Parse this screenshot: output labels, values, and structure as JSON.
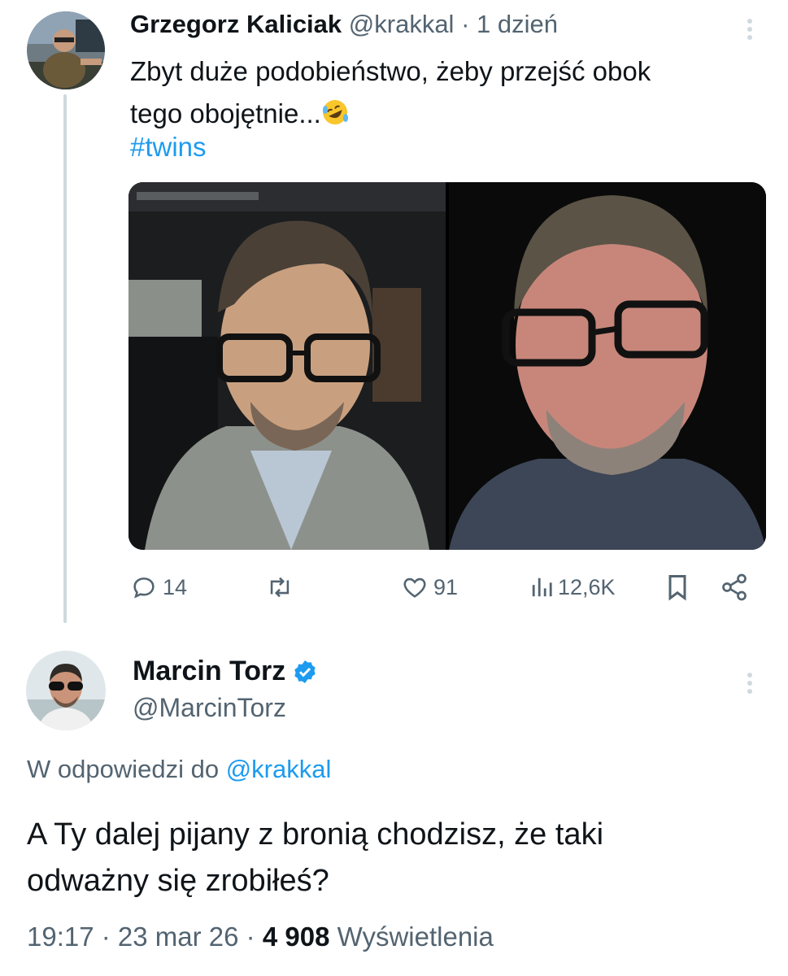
{
  "tweet1": {
    "author_name": "Grzegorz Kaliciak",
    "handle": "@krakkal",
    "separator": " · ",
    "time": "1 dzień",
    "text_line1": "Zbyt duże podobieństwo, żeby przejść obok",
    "text_line2": "tego obojętnie...",
    "emoji": "rolling-on-floor-laughing",
    "hashtag": "#twins",
    "actions": {
      "replies": "14",
      "likes": "91",
      "views": "12,6K"
    }
  },
  "tweet2": {
    "author_name": "Marcin Torz",
    "verified": true,
    "handle": "@MarcinTorz",
    "reply_prefix": "W odpowiedzi do ",
    "reply_mention": "@krakkal",
    "text_line1": "A Ty dalej pijany z bronią chodzisz, że taki",
    "text_line2": "odważny się zrobiłeś?",
    "time": "19:17",
    "date": "23 mar 26",
    "dot": " · ",
    "views_count": "4 908",
    "views_label": " Wyświetlenia"
  },
  "colors": {
    "accent": "#1d9bf0",
    "muted": "#536471",
    "text": "#0f1419",
    "thread_line": "#cfd9de"
  },
  "icons": [
    "reply-icon",
    "retweet-icon",
    "like-icon",
    "views-icon",
    "bookmark-icon",
    "share-icon",
    "more-options-icon",
    "verified-badge-icon"
  ]
}
